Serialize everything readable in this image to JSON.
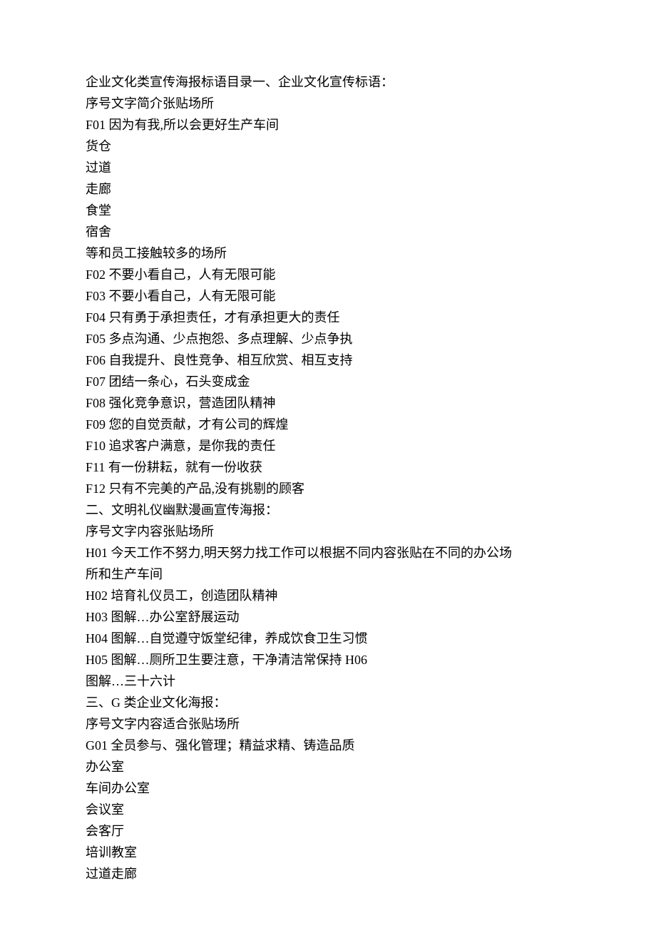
{
  "lines": [
    "企业文化类宣传海报标语目录一、企业文化宣传标语：",
    "序号文字简介张贴场所",
    "F01 因为有我,所以会更好生产车间",
    "货仓",
    "过道",
    "走廊",
    "食堂",
    "宿舍",
    "等和员工接触较多的场所",
    "F02 不要小看自己，人有无限可能",
    "F03 不要小看自己，人有无限可能",
    "F04 只有勇于承担责任，才有承担更大的责任",
    "F05 多点沟通、少点抱怨、多点理解、少点争执",
    "F06 自我提升、良性竞争、相互欣赏、相互支持",
    "F07 团结一条心，石头变成金",
    "F08 强化竞争意识，营造团队精神",
    "F09 您的自觉贡献，才有公司的辉煌",
    "F10 追求客户满意，是你我的责任",
    "F11 有一份耕耘，就有一份收获",
    "F12 只有不完美的产品,没有挑剔的顾客",
    "二、文明礼仪幽默漫画宣传海报：",
    "序号文字内容张贴场所",
    "H01 今天工作不努力,明天努力找工作可以根据不同内容张贴在不同的办公场",
    "所和生产车间",
    "H02 培育礼仪员工，创造团队精神",
    "H03 图解…办公室舒展运动",
    "H04 图解…自觉遵守饭堂纪律，养成饮食卫生习惯",
    "H05 图解…厕所卫生要注意，干净清洁常保持 H06",
    "图解…三十六计",
    "三、G 类企业文化海报：",
    "序号文字内容适合张贴场所",
    "G01 全员参与、强化管理；精益求精、铸造品质",
    "办公室",
    "车间办公室",
    "会议室",
    "会客厅",
    "培训教室",
    "过道走廊"
  ]
}
